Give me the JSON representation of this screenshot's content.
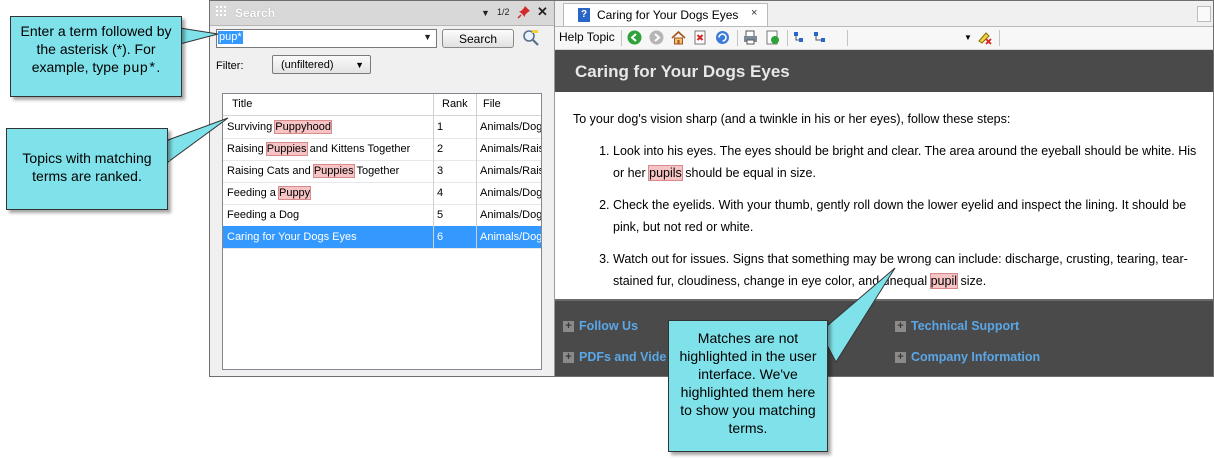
{
  "search_pane": {
    "title": "Search",
    "page_indicator": "1/2",
    "search_term": "pup*",
    "search_button": "Search",
    "filter_label": "Filter:",
    "filter_value": "(unfiltered)",
    "columns": {
      "title": "Title",
      "rank": "Rank",
      "file": "File"
    },
    "results": [
      {
        "pre": "Surviving ",
        "match": "Puppyhood",
        "post": "",
        "rank": "1",
        "file": "Animals/Dog"
      },
      {
        "pre": "Raising ",
        "match": "Puppies",
        "post": " and Kittens Together",
        "rank": "2",
        "file": "Animals/Rais"
      },
      {
        "pre": "Raising Cats and ",
        "match": "Puppies",
        "post": " Together",
        "rank": "3",
        "file": "Animals/Rais"
      },
      {
        "pre": "Feeding a ",
        "match": "Puppy",
        "post": "",
        "rank": "4",
        "file": "Animals/Dog"
      },
      {
        "pre": "Feeding a Dog",
        "match": "",
        "post": "",
        "rank": "5",
        "file": "Animals/Dog"
      },
      {
        "pre": "Caring for Your Dogs Eyes",
        "match": "",
        "post": "",
        "rank": "6",
        "file": "Animals/Dog"
      }
    ]
  },
  "topic_pane": {
    "tab_title": "Caring for Your Dogs Eyes",
    "tab_close": "×",
    "toolbar_label": "Help Topic",
    "heading": "Caring for Your Dogs Eyes",
    "intro": "To your dog's vision sharp (and a twinkle in his or her eyes), follow these steps:",
    "steps": [
      {
        "pre": "Look into his eyes. The eyes should be bright and clear. The area around the eyeball should be white. His or her ",
        "match": "pupils",
        "post": " should be equal in size."
      },
      {
        "pre": "Check the eyelids. With your thumb, gently roll down the lower eyelid and inspect the lining. It should be pink, but not red or white.",
        "match": "",
        "post": ""
      },
      {
        "pre": "Watch out for issues. Signs that something may be wrong can include: discharge, crusting, tearing, tear-stained fur, cloudiness, change in eye color, and unequal ",
        "match": "pupil",
        "post": " size."
      }
    ],
    "footer_links": {
      "follow_us": "Follow Us",
      "pdfs": "PDFs and Vide",
      "support": "Technical Support",
      "company": "Company Information"
    }
  },
  "callouts": {
    "enter_term_pre": "Enter a term followed by the asterisk (*). For example, type ",
    "enter_term_code": "pup*",
    "enter_term_post": ".",
    "topics_ranked": "Topics with matching terms are ranked.",
    "not_highlighted": "Matches are not highlighted in the user interface. We've highlighted them here to show you matching terms."
  },
  "colors": {
    "callout": "#7fe1e9",
    "selection": "#3399ff",
    "highlight": "#f6c4c4",
    "topic_banner": "#4a4a4a",
    "footer_link": "#5aa7e8"
  }
}
